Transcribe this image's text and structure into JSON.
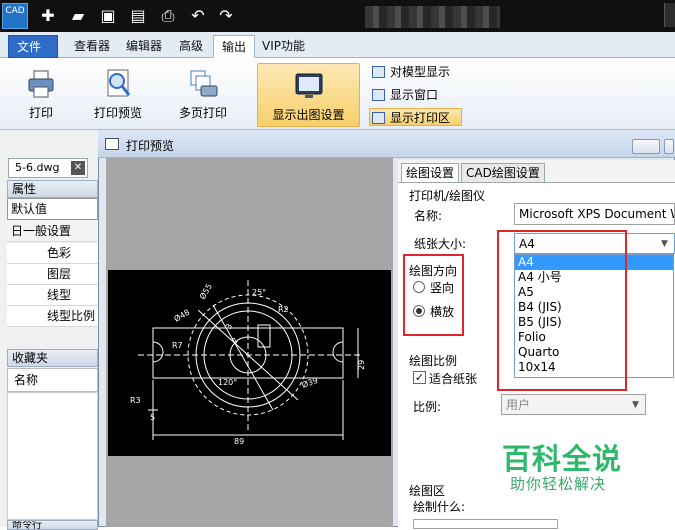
{
  "app": {
    "logo_text": "CAD"
  },
  "ribbon_tabs": [
    {
      "label": "文件"
    },
    {
      "label": "查看器"
    },
    {
      "label": "编辑器"
    },
    {
      "label": "高级"
    },
    {
      "label": "输出"
    },
    {
      "label": "VIP功能"
    }
  ],
  "ribbon": {
    "print": "打印",
    "print_preview": "打印预览",
    "multi_print": "多页打印",
    "show_output": "显示出图设置",
    "model_display": "对模型显示",
    "show_window": "显示窗口",
    "show_print_area": "显示打印区"
  },
  "left_panel": {
    "file_tab": "5-6.dwg",
    "file_tab_close": "✕",
    "properties_header": "属性",
    "default_value": "默认值",
    "general_settings": "日一般设置",
    "rows": [
      "色彩",
      "图层",
      "线型",
      "线型比例"
    ],
    "favorites_header": "收藏夹",
    "name_header": "名称",
    "bottom_cut": "命令行"
  },
  "dialog": {
    "title": "打印预览",
    "tabs": [
      {
        "label": "绘图设置"
      },
      {
        "label": "CAD绘图设置"
      }
    ],
    "printer_group": "打印机/绘图仪",
    "name_label": "名称:",
    "printer_name": "Microsoft XPS Document Writer",
    "paper_size_label": "纸张大小:",
    "paper_size_value": "A4",
    "paper_options": [
      "A4",
      "A4 小号",
      "A5",
      "B4 (JIS)",
      "B5 (JIS)",
      "Folio",
      "Quarto",
      "10x14"
    ],
    "orientation_group": "绘图方向",
    "portrait": "竖向",
    "landscape": "横放",
    "scale_group": "绘图比例",
    "fit_paper": "适合纸张",
    "scale_label": "比例:",
    "scale_value": "用户",
    "area_group": "绘图区",
    "draw_what": "绘制什么:"
  },
  "cad_dims": {
    "d1": "Ø55",
    "d2": "25°",
    "d3": "Ø48",
    "d4": "R2",
    "d5": "R7",
    "d6": "120°",
    "d7": "Ø39",
    "d8": "29",
    "d9": "R3",
    "d10": "5",
    "d11": "89",
    "d12": "3",
    "d13": "2"
  },
  "watermark": {
    "title": "百科全说",
    "subtitle": "助你轻松解决"
  },
  "colors": {
    "accent": "#2f6cc5",
    "highlight": "#f7cf6b",
    "red_box": "#e0252b",
    "watermark": "#2db86a"
  }
}
